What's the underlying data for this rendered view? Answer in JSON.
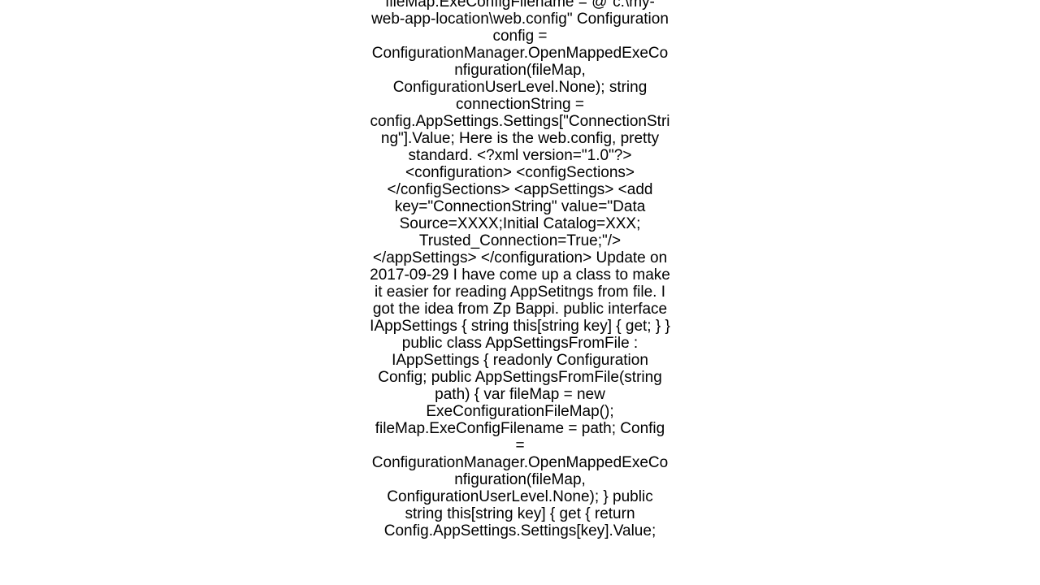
{
  "document": {
    "text": "fileMap.ExeConfigFilename = @\"c:\\my-web-app-location\\web.config\"  Configuration config = ConfigurationManager.OpenMappedExeConfiguration(fileMap, ConfigurationUserLevel.None); string connectionString = config.AppSettings.Settings[\"ConnectionString\"].Value;  Here is the web.config, pretty standard.  <?xml version=\"1.0\"?> <configuration>   <configSections>   </configSections>   <appSettings>     <add key=\"ConnectionString\" value=\"Data Source=XXXX;Initial Catalog=XXX; Trusted_Connection=True;\"/>   </appSettings> </configuration>  Update on 2017-09-29 I have come up a class to make it easier for reading AppSetitngs from file.  I got the idea from Zp Bappi. public interface IAppSettings {     string this[string key] { get; } }  public class AppSettingsFromFile : IAppSettings {     readonly Configuration Config;      public AppSettingsFromFile(string path)     {         var fileMap = new ExeConfigurationFileMap();         fileMap.ExeConfigFilename = path;         Config = ConfigurationManager.OpenMappedExeConfiguration(fileMap, ConfigurationUserLevel.None);     }      public string this[string key]     {         get         {             return Config.AppSettings.Settings[key].Value;"
  }
}
